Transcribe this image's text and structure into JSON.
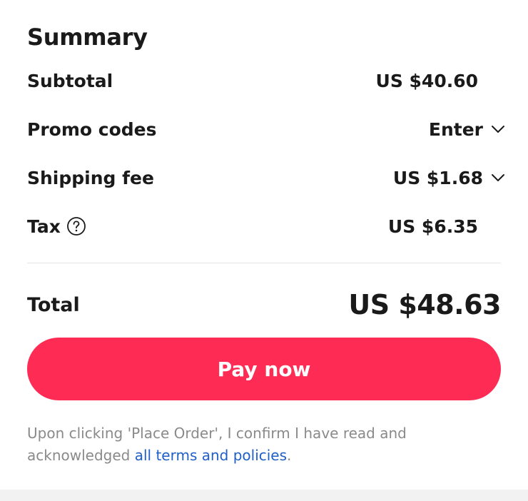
{
  "summary": {
    "title": "Summary",
    "rows": {
      "subtotal": {
        "label": "Subtotal",
        "value": "US $40.60"
      },
      "promo": {
        "label": "Promo codes",
        "value": "Enter",
        "icon": "chevron-down-icon"
      },
      "shipping": {
        "label": "Shipping fee",
        "value": "US $1.68",
        "icon": "chevron-down-icon"
      },
      "tax": {
        "label": "Tax",
        "value": "US $6.35",
        "icon": "help-circle-icon"
      }
    },
    "total": {
      "label": "Total",
      "value": "US $48.63"
    }
  },
  "pay_button": {
    "label": "Pay now"
  },
  "disclaimer": {
    "text_before": "Upon clicking 'Place Order', I confirm I have read and acknowledged ",
    "link": "all terms and policies",
    "text_after": "."
  },
  "colors": {
    "accent": "#fe2c55",
    "link": "#1f5fc7",
    "muted_text": "#8a8a8a",
    "primary_text": "#1a1a1a",
    "divider": "#e6e6e6",
    "footer_strip": "#f2f2f2"
  }
}
